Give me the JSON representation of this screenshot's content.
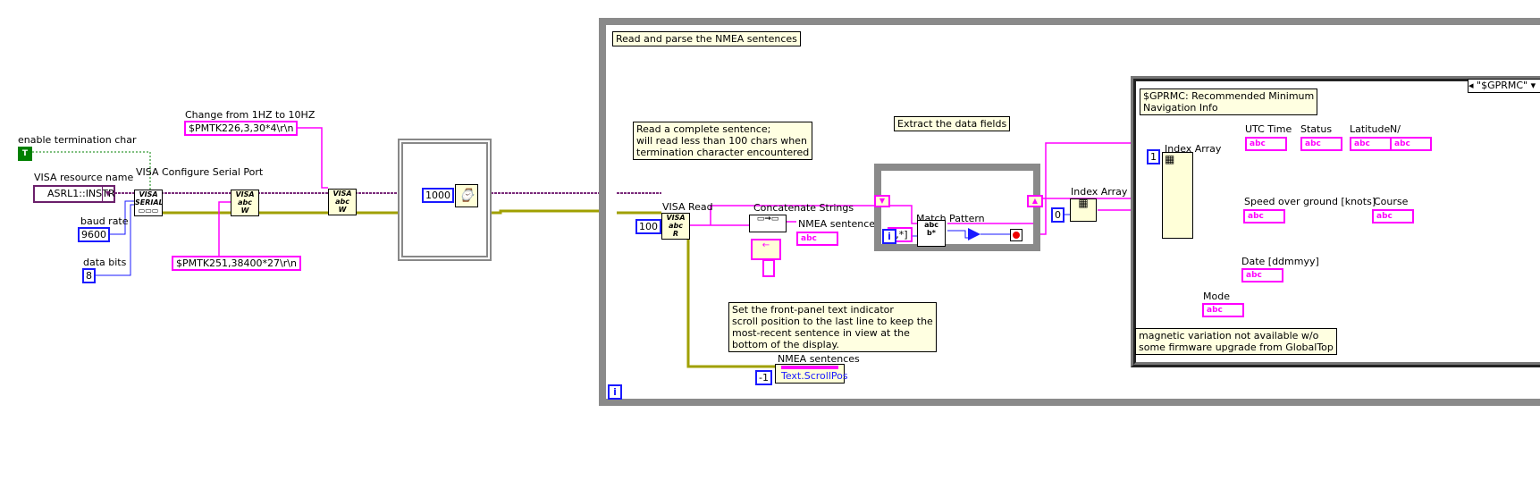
{
  "left": {
    "term_char_label": "enable termination char",
    "term_char_value": "T",
    "resource_label": "VISA resource name",
    "resource_value": "ASRL1::INSTR",
    "baud_label": "baud rate",
    "baud_value": "9600",
    "bits_label": "data bits",
    "bits_value": "8",
    "configure_label": "VISA Configure Serial Port",
    "rate_comment": "Change from 1HZ to 10HZ",
    "rate_cmd": "$PMTK226,3,30*4\\r\\n",
    "baud_cmd": "$PMTK251,38400*27\\r\\n",
    "wait_ms": "1000"
  },
  "loop": {
    "title_comment": "Read and parse the NMEA sentences",
    "read_comment": "Read a complete sentence;\nwill read less than 100 chars when\ntermination character encountered",
    "visa_read_label": "VISA Read",
    "read_count": "100",
    "concat_label": "Concatenate Strings",
    "nmea_label": "NMEA sentences",
    "extract_comment": "Extract the data fields",
    "match_label": "Match Pattern",
    "pattern": "[,*]",
    "index_label": "Index Array",
    "index_value": "0",
    "scroll_comment": "Set the front-panel text indicator\nscroll position to the last line to keep the\nmost-recent sentence in view at the\nbottom of the display.",
    "prop_owner": "NMEA sentences",
    "prop_name": "Text.ScrollPos",
    "prop_value": "-1",
    "iteration": "i",
    "indicator_glyph": "abc"
  },
  "case": {
    "selector": "\"$GPRMC\"",
    "comment": "$GPRMC: Recommended Minimum\nNavigation Info",
    "index_label": "Index Array",
    "index_value": "1",
    "fields": [
      "UTC Time",
      "Status",
      "Latitude",
      "N/",
      "Speed over ground [knots]",
      "Course",
      "Date [ddmmyy]",
      "Mode"
    ],
    "mag_comment": "magnetic variation not available w/o\nsome firmware upgrade from GlobalTop"
  },
  "colors": {
    "string": "#ff00ff",
    "numeric": "#1a1aff",
    "visa": "#6b1f6b",
    "error": "#c8c800",
    "boolean": "#008000",
    "structure": "#8a8a8a"
  }
}
